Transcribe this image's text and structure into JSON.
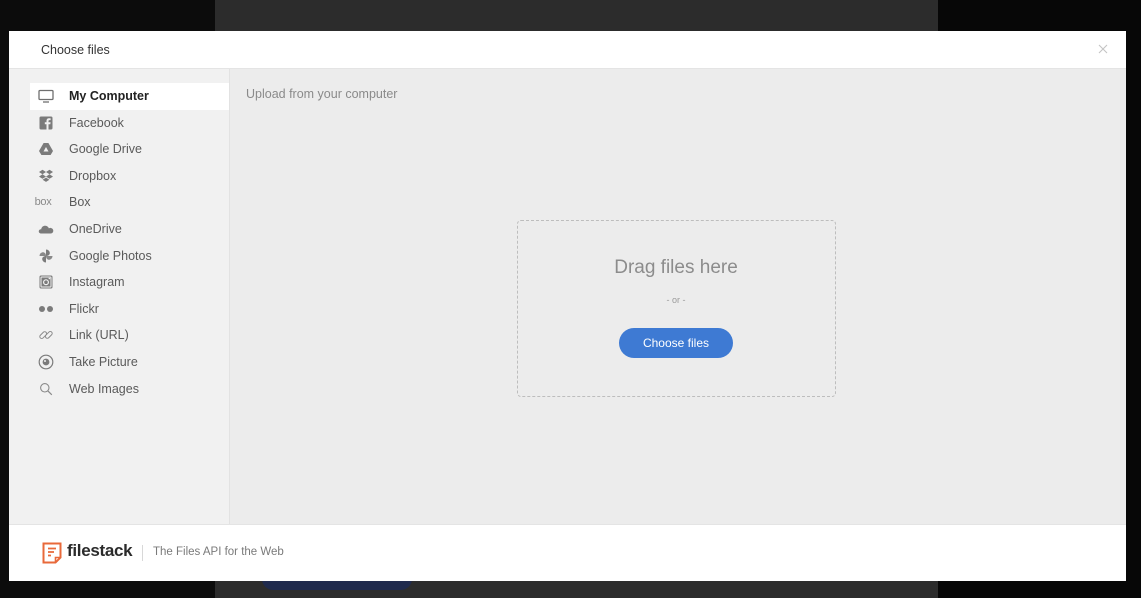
{
  "dialog": {
    "title": "Choose files"
  },
  "sidebar": {
    "items": [
      {
        "label": "My Computer",
        "icon": "monitor-icon",
        "active": true
      },
      {
        "label": "Facebook",
        "icon": "facebook-icon"
      },
      {
        "label": "Google Drive",
        "icon": "google-drive-icon"
      },
      {
        "label": "Dropbox",
        "icon": "dropbox-icon"
      },
      {
        "label": "Box",
        "icon": "box-icon",
        "icon_text": "box"
      },
      {
        "label": "OneDrive",
        "icon": "onedrive-icon"
      },
      {
        "label": "Google Photos",
        "icon": "google-photos-icon"
      },
      {
        "label": "Instagram",
        "icon": "instagram-icon"
      },
      {
        "label": "Flickr",
        "icon": "flickr-icon"
      },
      {
        "label": "Link (URL)",
        "icon": "link-icon"
      },
      {
        "label": "Take Picture",
        "icon": "camera-icon"
      },
      {
        "label": "Web Images",
        "icon": "search-icon"
      }
    ]
  },
  "content": {
    "heading": "Upload from your computer",
    "dropzone": {
      "title": "Drag files here",
      "separator": "- or -",
      "button_label": "Choose files"
    }
  },
  "footer": {
    "brand": "filestack",
    "tagline": "The Files API for the Web"
  },
  "colors": {
    "accent": "#3e7ad3",
    "brand": "#e8693a"
  }
}
